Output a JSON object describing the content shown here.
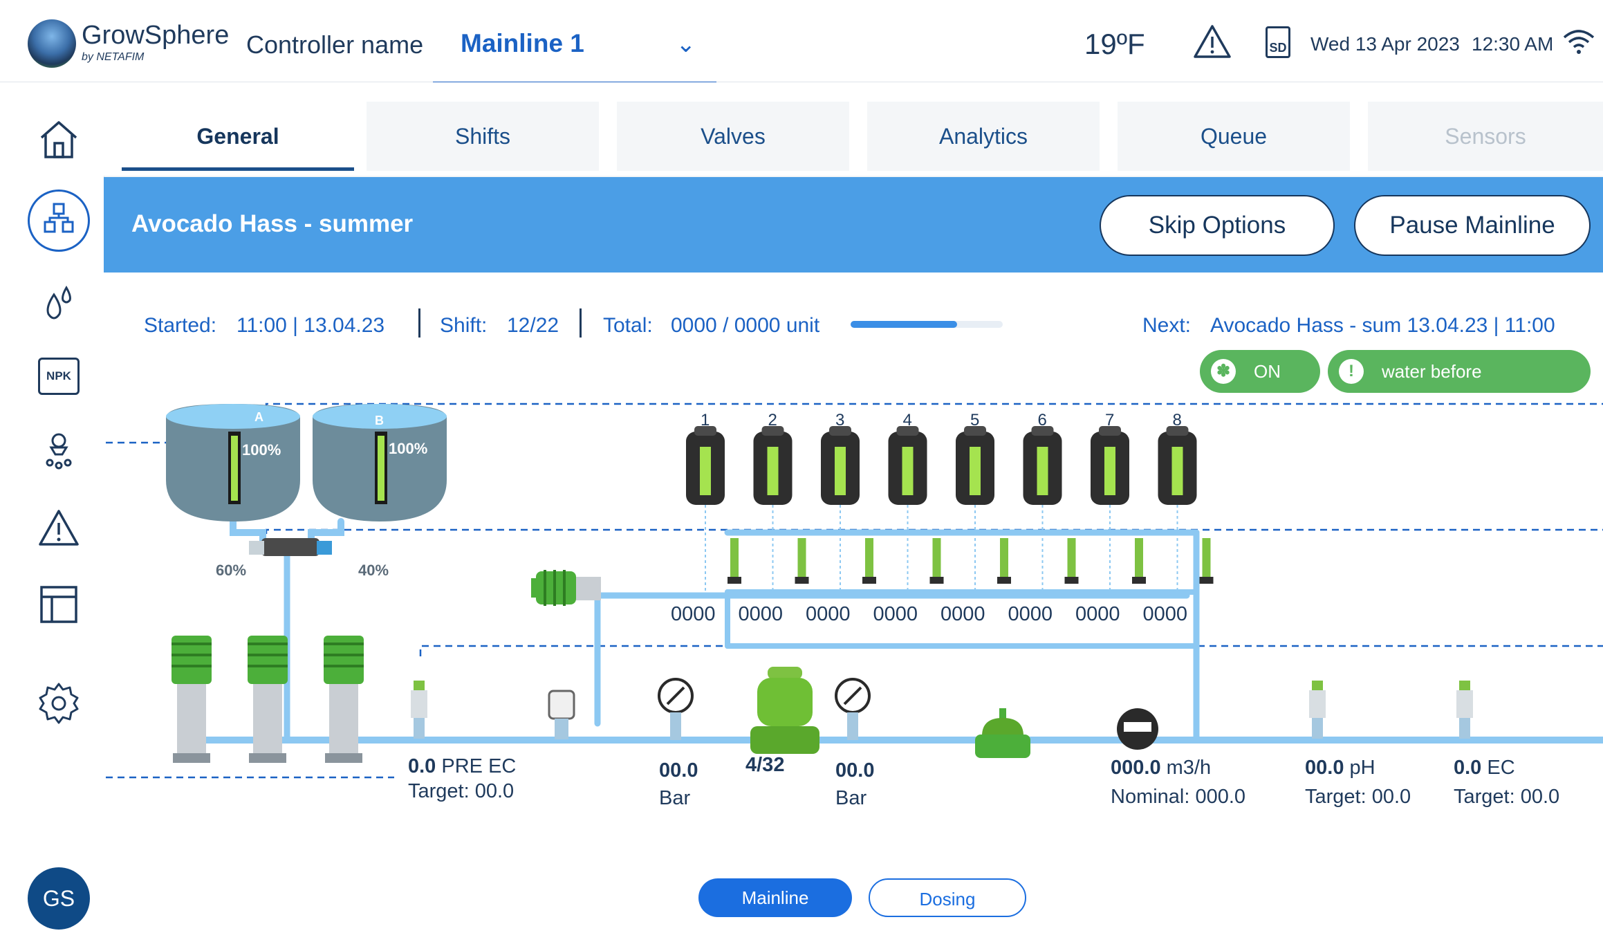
{
  "header": {
    "brand_name": "GrowSphere",
    "brand_by": "by NETAFIM",
    "controller_label": "Controller name",
    "controller_value": "Mainline 1",
    "temperature": "19ºF",
    "sd_label": "SD",
    "date": "Wed 13 Apr 2023",
    "time": "12:30 AM"
  },
  "sidebar": {
    "items": [
      "home-icon",
      "system-icon",
      "drops-icon",
      "npk-icon",
      "sprinkler-icon",
      "alert-icon",
      "layout-icon",
      "settings-icon"
    ],
    "npk_label": "NPK",
    "avatar": "GS"
  },
  "tabs": [
    {
      "label": "General",
      "state": "active"
    },
    {
      "label": "Shifts",
      "state": "normal"
    },
    {
      "label": "Valves",
      "state": "normal"
    },
    {
      "label": "Analytics",
      "state": "normal"
    },
    {
      "label": "Queue",
      "state": "normal"
    },
    {
      "label": "Sensors",
      "state": "disabled"
    }
  ],
  "banner": {
    "title": "Avocado Hass - summer",
    "skip_label": "Skip Options",
    "pause_label": "Pause Mainline"
  },
  "info": {
    "started_label": "Started:",
    "started_value": "11:00 | 13.04.23",
    "shift_label": "Shift:",
    "shift_value": "12/22",
    "total_label": "Total:",
    "total_value": "0000 / 0000 unit",
    "progress": 0.7,
    "next_label": "Next:",
    "next_value": "Avocado Hass - sum  13.04.23 | 11:00"
  },
  "status": {
    "on_label": "ON",
    "water_before_label": "water before",
    "water_icon_glyph": "!"
  },
  "tanks": [
    {
      "name": "A",
      "level": "100%",
      "mix": "60%"
    },
    {
      "name": "B",
      "level": "100%",
      "mix": "40%"
    }
  ],
  "dosing_channels": [
    "1",
    "2",
    "3",
    "4",
    "5",
    "6",
    "7",
    "8"
  ],
  "dosing_counts": [
    "0000",
    "0000",
    "0000",
    "0000",
    "0000",
    "0000",
    "0000",
    "0000"
  ],
  "readings": {
    "pre_ec_value": "0.0",
    "pre_ec_unit": "PRE EC",
    "pre_ec_target": "Target: 00.0",
    "pressure1_value": "00.0",
    "pressure1_unit": "Bar",
    "filter_value": "4/32",
    "pressure2_value": "00.0",
    "pressure2_unit": "Bar",
    "flow_value": "000.0",
    "flow_unit": "m3/h",
    "flow_nominal": "Nominal: 000.0",
    "ph_value": "00.0",
    "ph_unit": "pH",
    "ph_target": "Target: 00.0",
    "ec_value": "0.0",
    "ec_unit": "EC",
    "ec_target": "Target: 00.0"
  },
  "segment": {
    "mainline_label": "Mainline",
    "dosing_label": "Dosing",
    "selected": "Mainline"
  },
  "colors": {
    "brand_blue": "#1b62c4",
    "banner_blue": "#4b9ee6",
    "pipe_blue": "#8cc8f2",
    "green": "#5ab55e",
    "equipment_green": "#7ec242"
  }
}
